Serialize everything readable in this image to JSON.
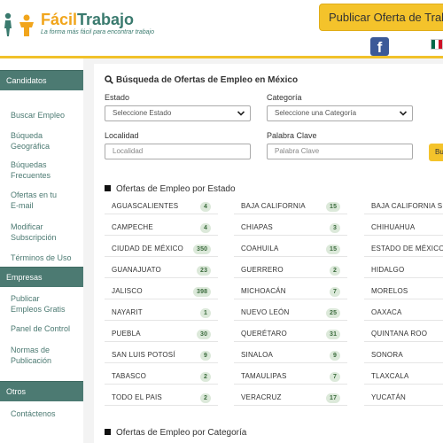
{
  "header": {
    "logo_title_part1": "Fácil",
    "logo_title_part2": "Trabajo",
    "logo_tagline": "La forma más fácil para encontrar trabajo",
    "publish_button": "Publicar Oferta de Trabajo",
    "facebook_icon": "facebook-icon",
    "facebook_glyph": "f",
    "flag_icon": "mexico-flag-icon"
  },
  "sidebar": {
    "sections": [
      {
        "title": "Candidatos",
        "links": [
          "Buscar Empleo",
          "Búqueda Geográfica",
          "Búquedas Frecuentes",
          "Ofertas en tu E-mail",
          "Modificar Subscripción",
          "Términos de Uso"
        ]
      },
      {
        "title": "Empresas",
        "links": [
          "Publicar Empleos Gratis",
          "Panel de Control",
          "Normas de Publicación"
        ]
      },
      {
        "title": "Otros",
        "links": [
          "Contáctenos"
        ]
      }
    ]
  },
  "search": {
    "title": "Búsqueda de Ofertas de Empleo en México",
    "estado_label": "Estado",
    "estado_value": "Seleccione Estado",
    "categoria_label": "Categoría",
    "categoria_value": "Seleccione una Categoría",
    "localidad_label": "Localidad",
    "localidad_placeholder": "Localidad",
    "palabra_label": "Palabra Clave",
    "palabra_placeholder": "Palabra Clave",
    "button": "Bu"
  },
  "states_section": {
    "title": "Ofertas de Empleo por Estado",
    "columns": [
      [
        {
          "name": "AGUASCALIENTES",
          "count": "4"
        },
        {
          "name": "CAMPECHE",
          "count": "4"
        },
        {
          "name": "CIUDAD DE MÉXICO",
          "count": "350"
        },
        {
          "name": "GUANAJUATO",
          "count": "23"
        },
        {
          "name": "JALISCO",
          "count": "398"
        },
        {
          "name": "NAYARIT",
          "count": "1"
        },
        {
          "name": "PUEBLA",
          "count": "30"
        },
        {
          "name": "SAN LUIS POTOSÍ",
          "count": "9"
        },
        {
          "name": "TABASCO",
          "count": "2"
        },
        {
          "name": "TODO EL PAIS",
          "count": "2"
        }
      ],
      [
        {
          "name": "BAJA CALIFORNIA",
          "count": "15"
        },
        {
          "name": "CHIAPAS",
          "count": "3"
        },
        {
          "name": "COAHUILA",
          "count": "15"
        },
        {
          "name": "GUERRERO",
          "count": "2"
        },
        {
          "name": "MICHOACÁN",
          "count": "7"
        },
        {
          "name": "NUEVO LEÓN",
          "count": "25"
        },
        {
          "name": "QUERÉTARO",
          "count": "31"
        },
        {
          "name": "SINALOA",
          "count": "9"
        },
        {
          "name": "TAMAULIPAS",
          "count": "7"
        },
        {
          "name": "VERACRUZ",
          "count": "17"
        }
      ],
      [
        {
          "name": "BAJA CALIFORNIA SUR",
          "count": ""
        },
        {
          "name": "CHIHUAHUA",
          "count": ""
        },
        {
          "name": "ESTADO DE MÉXICO",
          "count": ""
        },
        {
          "name": "HIDALGO",
          "count": ""
        },
        {
          "name": "MORELOS",
          "count": ""
        },
        {
          "name": "OAXACA",
          "count": ""
        },
        {
          "name": "QUINTANA ROO",
          "count": ""
        },
        {
          "name": "SONORA",
          "count": ""
        },
        {
          "name": "TLAXCALA",
          "count": ""
        },
        {
          "name": "YUCATÁN",
          "count": ""
        }
      ]
    ]
  },
  "category_section": {
    "title": "Ofertas de Empleo por Categoría"
  }
}
